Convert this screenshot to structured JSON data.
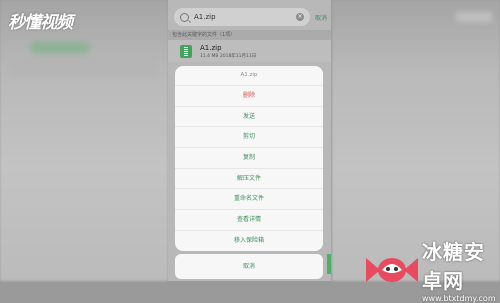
{
  "watermark_left": "秒懂视频",
  "search": {
    "value": "A1.zip",
    "cancel_label": "取消"
  },
  "results": {
    "header": "包含此关键字的文件（1项）",
    "item": {
      "name": "A1.zip",
      "meta": "11.4 MB  2018年11月11日"
    }
  },
  "sheet": {
    "title": "A1.zip",
    "items": [
      {
        "label": "删除",
        "danger": true
      },
      {
        "label": "发送"
      },
      {
        "label": "剪切"
      },
      {
        "label": "复制"
      },
      {
        "label": "解压文件"
      },
      {
        "label": "重命名文件"
      },
      {
        "label": "查看详情"
      },
      {
        "label": "移入保险箱"
      }
    ],
    "cancel_label": "取消"
  },
  "watermark_right": {
    "title": "冰糖安卓网",
    "url": "www.btxtdmy.com"
  },
  "colors": {
    "accent": "#3f8f5c",
    "danger": "#d9534f",
    "zip_icon": "#43a35d"
  }
}
